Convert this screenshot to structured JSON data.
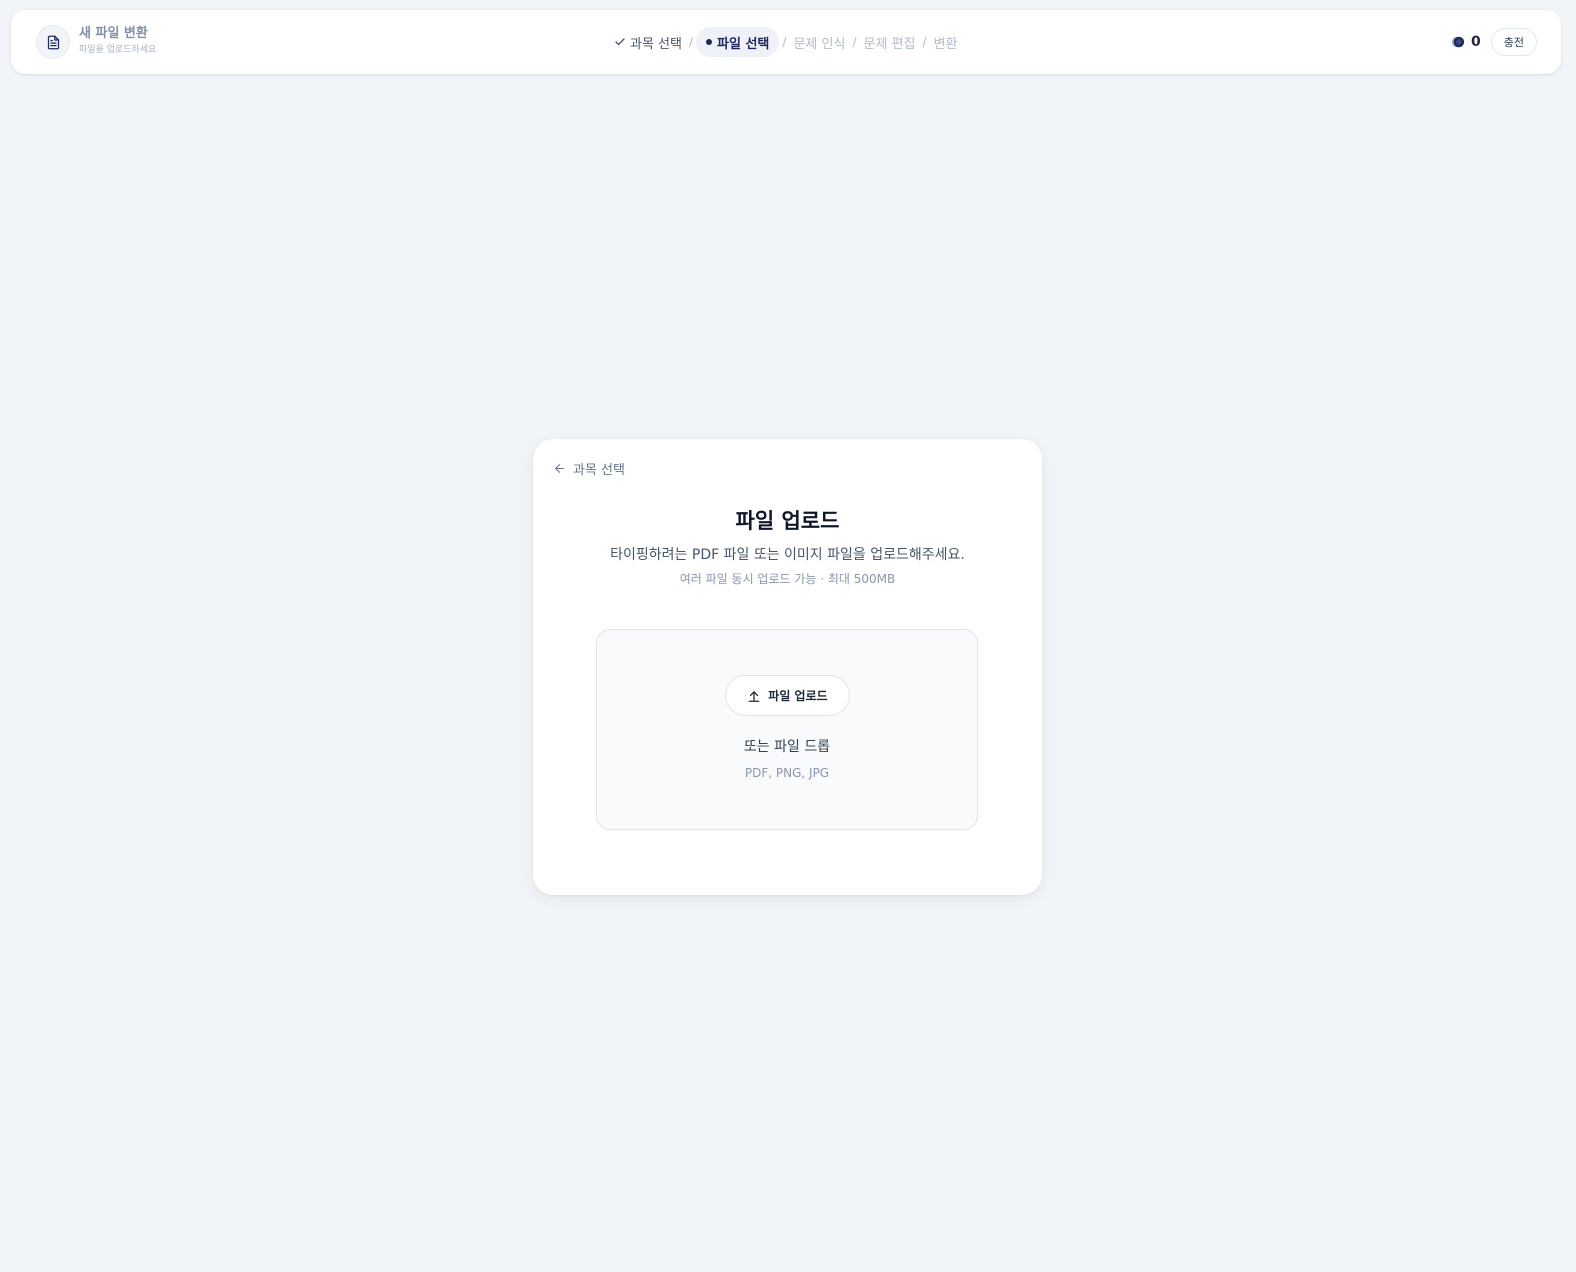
{
  "header": {
    "title": "새 파일 변환",
    "subtitle": "파일을 업로드하세요",
    "document_icon": "document-icon"
  },
  "steps": [
    {
      "label": "과목 선택",
      "state": "done"
    },
    {
      "label": "파일 선택",
      "state": "active"
    },
    {
      "label": "문제 인식",
      "state": "todo"
    },
    {
      "label": "문제 편집",
      "state": "todo"
    },
    {
      "label": "변환",
      "state": "todo"
    }
  ],
  "step_separator": "/",
  "credits": {
    "count": "0",
    "icon": "coin-icon",
    "charge_label": "충전"
  },
  "upload_card": {
    "back_label": "과목 선택",
    "title": "파일 업로드",
    "description": "타이핑하려는 PDF 파일 또는 이미지 파일을 업로드해주세요.",
    "note": "여러 파일 동시 업로드 가능 · 최대 500MB",
    "upload_button_label": "파일 업로드",
    "drop_text": "또는 파일 드롭",
    "accepted_types": "PDF, PNG, JPG"
  },
  "colors": {
    "accent": "#1e2a5c",
    "background": "#f1f4f9",
    "card": "#ffffff"
  }
}
